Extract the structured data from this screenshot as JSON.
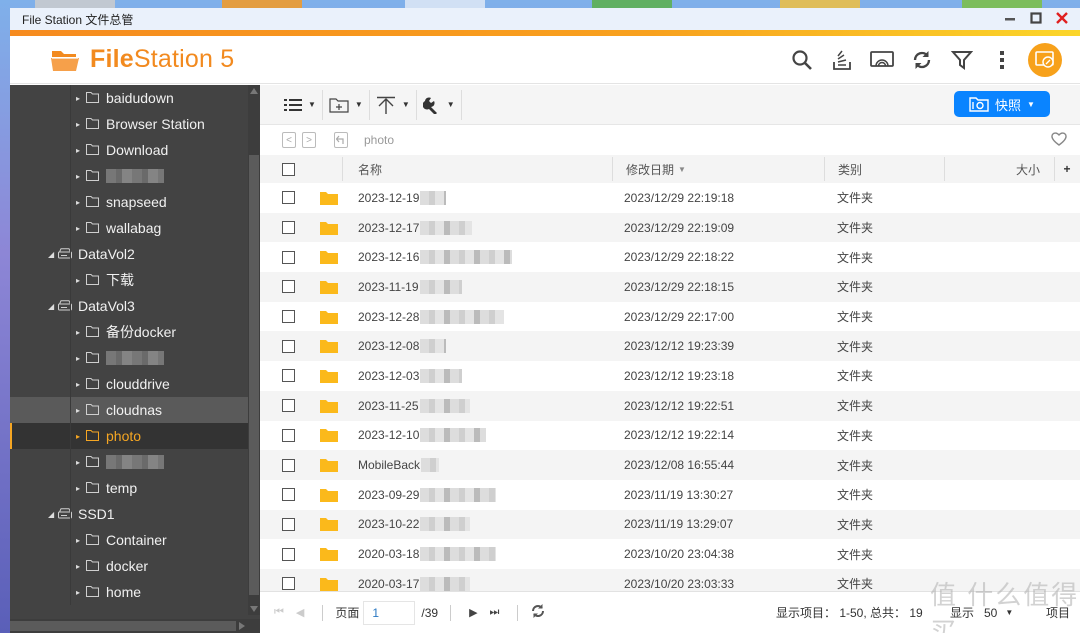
{
  "window": {
    "title": "File Station 文件总管",
    "controls": [
      "minimize",
      "maximize",
      "close"
    ]
  },
  "app": {
    "brand_bold": "File",
    "brand_rest": "Station 5",
    "header_tools": [
      "search-icon",
      "sharing-icon",
      "media-stream-icon",
      "refresh-icon",
      "filter-icon",
      "more-icon",
      "remote-mount-icon"
    ]
  },
  "sidebar": {
    "items": [
      {
        "label": "baidudown",
        "level": 2,
        "type": "folder"
      },
      {
        "label": "Browser Station",
        "level": 2,
        "type": "folder"
      },
      {
        "label": "Download",
        "level": 2,
        "type": "folder"
      },
      {
        "label": "",
        "level": 2,
        "type": "folder",
        "blurred": true
      },
      {
        "label": "snapseed",
        "level": 2,
        "type": "folder"
      },
      {
        "label": "wallabag",
        "level": 2,
        "type": "folder"
      },
      {
        "label": "DataVol2",
        "level": 1,
        "type": "volume"
      },
      {
        "label": "下载",
        "level": 2,
        "type": "folder"
      },
      {
        "label": "DataVol3",
        "level": 1,
        "type": "volume"
      },
      {
        "label": "备份docker",
        "level": 2,
        "type": "folder"
      },
      {
        "label": "",
        "level": 2,
        "type": "folder",
        "blurred": true
      },
      {
        "label": "clouddrive",
        "level": 2,
        "type": "folder"
      },
      {
        "label": "cloudnas",
        "level": 2,
        "type": "folder",
        "state": "hover"
      },
      {
        "label": "photo",
        "level": 2,
        "type": "folder",
        "state": "active"
      },
      {
        "label": "",
        "level": 2,
        "type": "folder",
        "blurred": true
      },
      {
        "label": "temp",
        "level": 2,
        "type": "folder"
      },
      {
        "label": "SSD1",
        "level": 1,
        "type": "volume"
      },
      {
        "label": "Container",
        "level": 2,
        "type": "folder"
      },
      {
        "label": "docker",
        "level": 2,
        "type": "folder"
      },
      {
        "label": "home",
        "level": 2,
        "type": "folder"
      }
    ]
  },
  "toolbar": {
    "snapshot_label": "快照",
    "buttons": [
      "view-mode",
      "create-folder",
      "upload",
      "tools"
    ]
  },
  "path": {
    "current": "photo"
  },
  "table": {
    "columns": {
      "name": "名称",
      "modified": "修改日期",
      "type": "类别",
      "size": "大小"
    },
    "rows": [
      {
        "name": "2023-12-19",
        "modified": "2023/12/29 22:19:18",
        "type": "文件夹",
        "blur": 26
      },
      {
        "name": "2023-12-17",
        "modified": "2023/12/29 22:19:09",
        "type": "文件夹",
        "blur": 52
      },
      {
        "name": "2023-12-16",
        "modified": "2023/12/29 22:18:22",
        "type": "文件夹",
        "blur": 92
      },
      {
        "name": "2023-11-19",
        "modified": "2023/12/29 22:18:15",
        "type": "文件夹",
        "blur": 42
      },
      {
        "name": "2023-12-28",
        "modified": "2023/12/29 22:17:00",
        "type": "文件夹",
        "blur": 84
      },
      {
        "name": "2023-12-08",
        "modified": "2023/12/12 19:23:39",
        "type": "文件夹",
        "blur": 26
      },
      {
        "name": "2023-12-03",
        "modified": "2023/12/12 19:23:18",
        "type": "文件夹",
        "blur": 42
      },
      {
        "name": "2023-11-25",
        "modified": "2023/12/12 19:22:51",
        "type": "文件夹",
        "blur": 50
      },
      {
        "name": "2023-12-10",
        "modified": "2023/12/12 19:22:14",
        "type": "文件夹",
        "blur": 66
      },
      {
        "name": "MobileBack",
        "modified": "2023/12/08 16:55:44",
        "type": "文件夹",
        "blur": 18
      },
      {
        "name": "2023-09-29",
        "modified": "2023/11/19 13:30:27",
        "type": "文件夹",
        "blur": 76
      },
      {
        "name": "2023-10-22",
        "modified": "2023/11/19 13:29:07",
        "type": "文件夹",
        "blur": 50
      },
      {
        "name": "2020-03-18",
        "modified": "2023/10/20 23:04:38",
        "type": "文件夹",
        "blur": 76
      },
      {
        "name": "2020-03-17",
        "modified": "2023/10/20 23:03:33",
        "type": "文件夹",
        "blur": 50
      }
    ]
  },
  "footer": {
    "page_label": "页面",
    "page_value": "1",
    "page_total": "/39",
    "display_info": "显示项目： 1-50, 总共： 19",
    "per_page_label": "显示",
    "per_page_value": "50",
    "items_label": "项目",
    "watermark": "值 什么值得买"
  }
}
